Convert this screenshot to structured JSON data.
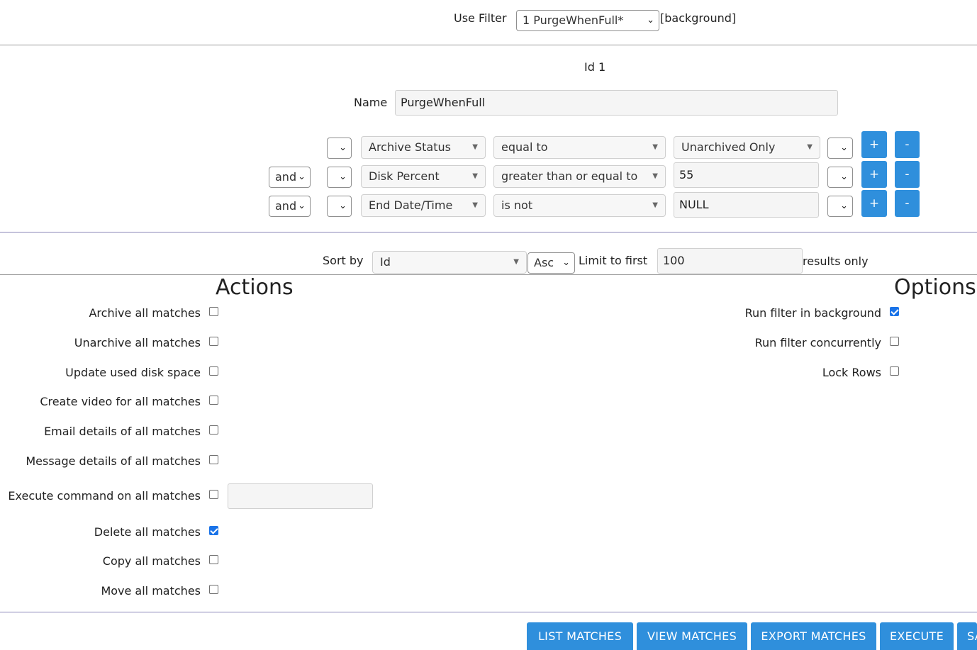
{
  "filter_bar": {
    "use_filter_label": "Use Filter",
    "selected_filter": "1 PurgeWhenFull*",
    "background_tag": "[background]"
  },
  "filter": {
    "id_text": "Id 1",
    "name_label": "Name",
    "name_value": "PurgeWhenFull"
  },
  "terms": [
    {
      "conj": "",
      "paren_open": "",
      "attribute": "Archive Status",
      "operator": "equal to",
      "value": "Unarchived Only",
      "value_is_select": true,
      "paren_close": ""
    },
    {
      "conj": "and",
      "paren_open": "",
      "attribute": "Disk Percent",
      "operator": "greater than or equal to",
      "value": "55",
      "value_is_select": false,
      "paren_close": ""
    },
    {
      "conj": "and",
      "paren_open": "",
      "attribute": "End Date/Time",
      "operator": "is not",
      "value": "NULL",
      "value_is_select": false,
      "paren_close": ""
    }
  ],
  "term_buttons": {
    "add": "+",
    "remove": "-"
  },
  "sort": {
    "sort_by_label": "Sort by",
    "field": "Id",
    "direction": "Asc",
    "limit_label": "Limit to first",
    "limit_value": "100",
    "results_only_label": "results only"
  },
  "actions": {
    "heading": "Actions",
    "items": [
      {
        "label": "Archive all matches",
        "checked": false
      },
      {
        "label": "Unarchive all matches",
        "checked": false
      },
      {
        "label": "Update used disk space",
        "checked": false
      },
      {
        "label": "Create video for all matches",
        "checked": false
      },
      {
        "label": "Email details of all matches",
        "checked": false
      },
      {
        "label": "Message details of all matches",
        "checked": false
      },
      {
        "label": "Execute command on all matches",
        "checked": false
      },
      {
        "label": "Delete all matches",
        "checked": true
      },
      {
        "label": "Copy all matches",
        "checked": false
      },
      {
        "label": "Move all matches",
        "checked": false
      }
    ],
    "execute_command_value": ""
  },
  "options": {
    "heading": "Options",
    "items": [
      {
        "label": "Run filter in background",
        "checked": true
      },
      {
        "label": "Run filter concurrently",
        "checked": false
      },
      {
        "label": "Lock Rows",
        "checked": false
      }
    ]
  },
  "footer_buttons": {
    "list": "LIST MATCHES",
    "view": "VIEW MATCHES",
    "export": "EXPORT MATCHES",
    "execute": "EXECUTE",
    "save": "SA"
  },
  "colors": {
    "accent": "#2f8fdc",
    "rule_grey": "#9a9a9a",
    "rule_purple": "#8a86b8",
    "checkbox_checked": "#1a73e8"
  }
}
